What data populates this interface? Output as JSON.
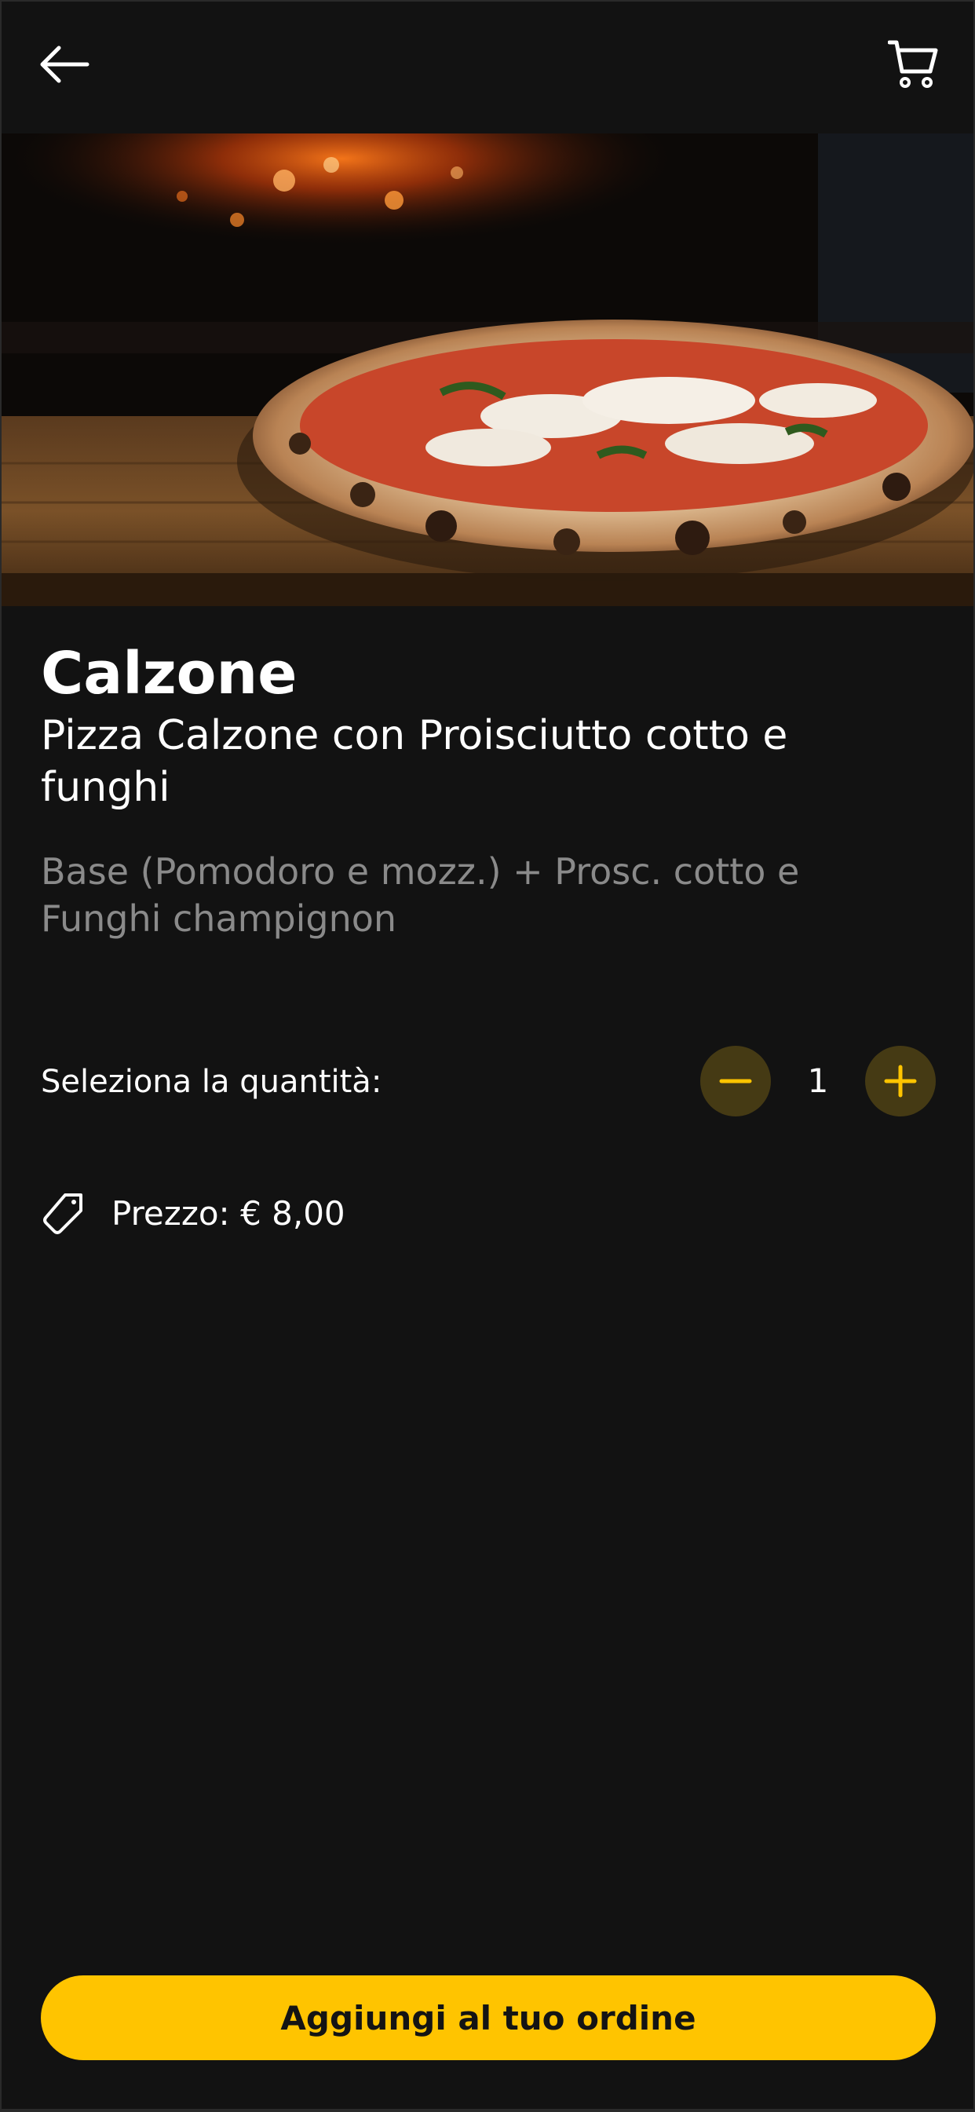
{
  "header": {
    "back_icon": "arrow-left-icon",
    "cart_icon": "shopping-cart-icon"
  },
  "hero": {
    "image": "pizza-photo"
  },
  "product": {
    "title": "Calzone",
    "subtitle": "Pizza Calzone con Proisciutto cotto e funghi",
    "description": "Base (Pomodoro e mozz.) + Prosc. cotto e Funghi champignon"
  },
  "quantity": {
    "label": "Seleziona la quantità:",
    "value": "1",
    "minus_icon": "minus-icon",
    "plus_icon": "plus-icon"
  },
  "price": {
    "icon": "price-tag-icon",
    "text": "Prezzo: € 8,00"
  },
  "cta": {
    "label": "Aggiungi al tuo ordine"
  },
  "colors": {
    "background": "#121212",
    "accent": "#ffc400",
    "stepper_bg": "#453a14",
    "muted_text": "#8a8a8a"
  }
}
